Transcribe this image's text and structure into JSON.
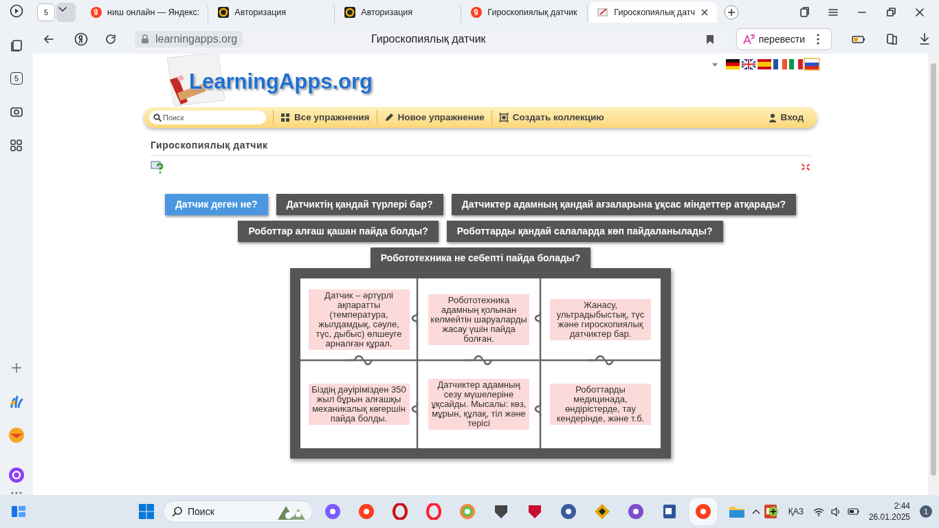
{
  "browser": {
    "tab_count": "5",
    "tabs": [
      {
        "title": "ниш онлайн — Яндекс:",
        "kind": "ya",
        "selected": false
      },
      {
        "title": "Авторизация",
        "kind": "la",
        "selected": false
      },
      {
        "title": "Авторизация",
        "kind": "la",
        "selected": false
      },
      {
        "title": "Гироскопиялық датчик",
        "kind": "ya",
        "selected": false
      },
      {
        "title": "Гироскопиялық датч",
        "kind": "pad",
        "selected": true
      }
    ],
    "address": "learningapps.org",
    "page_title": "Гироскопиялық датчик",
    "translate": "перевести"
  },
  "sidebar": {
    "badge": "5"
  },
  "site": {
    "logo": "LearningApps.org",
    "languages": [
      {
        "kind": "de",
        "selected": false
      },
      {
        "kind": "gb",
        "selected": false
      },
      {
        "kind": "es",
        "selected": false
      },
      {
        "kind": "fr",
        "selected": false
      },
      {
        "kind": "it",
        "selected": false
      },
      {
        "kind": "ru",
        "selected": true
      }
    ],
    "search": {
      "placeholder": "Поиск"
    },
    "nav": [
      {
        "kind": "grid",
        "label": "Все упражнения"
      },
      {
        "kind": "pencil",
        "label": "Новое упражнение"
      },
      {
        "kind": "frame",
        "label": "Создать коллекцию"
      }
    ],
    "login": "Вход"
  },
  "exercise": {
    "title": "Гироскопиялық датчик",
    "questions": [
      [
        {
          "label": "Датчик деген не?",
          "selected": true
        },
        {
          "label": "Датчиктің қандай түрлері бар?",
          "selected": false
        },
        {
          "label": "Датчиктер адамның қандай ағзаларына ұқсас міндеттер атқарады?",
          "selected": false
        }
      ],
      [
        {
          "label": "Роботтар алғаш қашан пайда болды?",
          "selected": false
        },
        {
          "label": "Роботтарды қандай салаларда көп пайдаланылады?",
          "selected": false
        }
      ],
      [
        {
          "label": "Робототехника не себепті пайда болады?",
          "selected": false
        }
      ]
    ],
    "pieces": [
      "Датчик – әртүрлі ақпаратты (температура, жылдамдық, сәуле, түс, дыбыс) өлшеуге арналған құрал.",
      "Робототехника адамның қолынан келмейтін шаруаларды жасау үшін пайда болған.",
      "Жанасу, ультрадыбыстық, түс және гироскопиялық датчиктер бар.",
      "Біздің дәуірімізден 350 жыл бұрын алғашқы механикалық көгершін пайда болды.",
      "Датчиктер адамның сезу мүшелеріне ұқсайды. Мысалы: көз, мұрын, құлақ, тіл және терісі",
      "Роботтарды медицинада, өндірістерде, тау кендерінде, және т.б."
    ]
  },
  "taskbar": {
    "search": "Поиск",
    "language": "ҚАЗ",
    "time": "2:44",
    "date": "26.01.2025",
    "notifications": "1"
  }
}
